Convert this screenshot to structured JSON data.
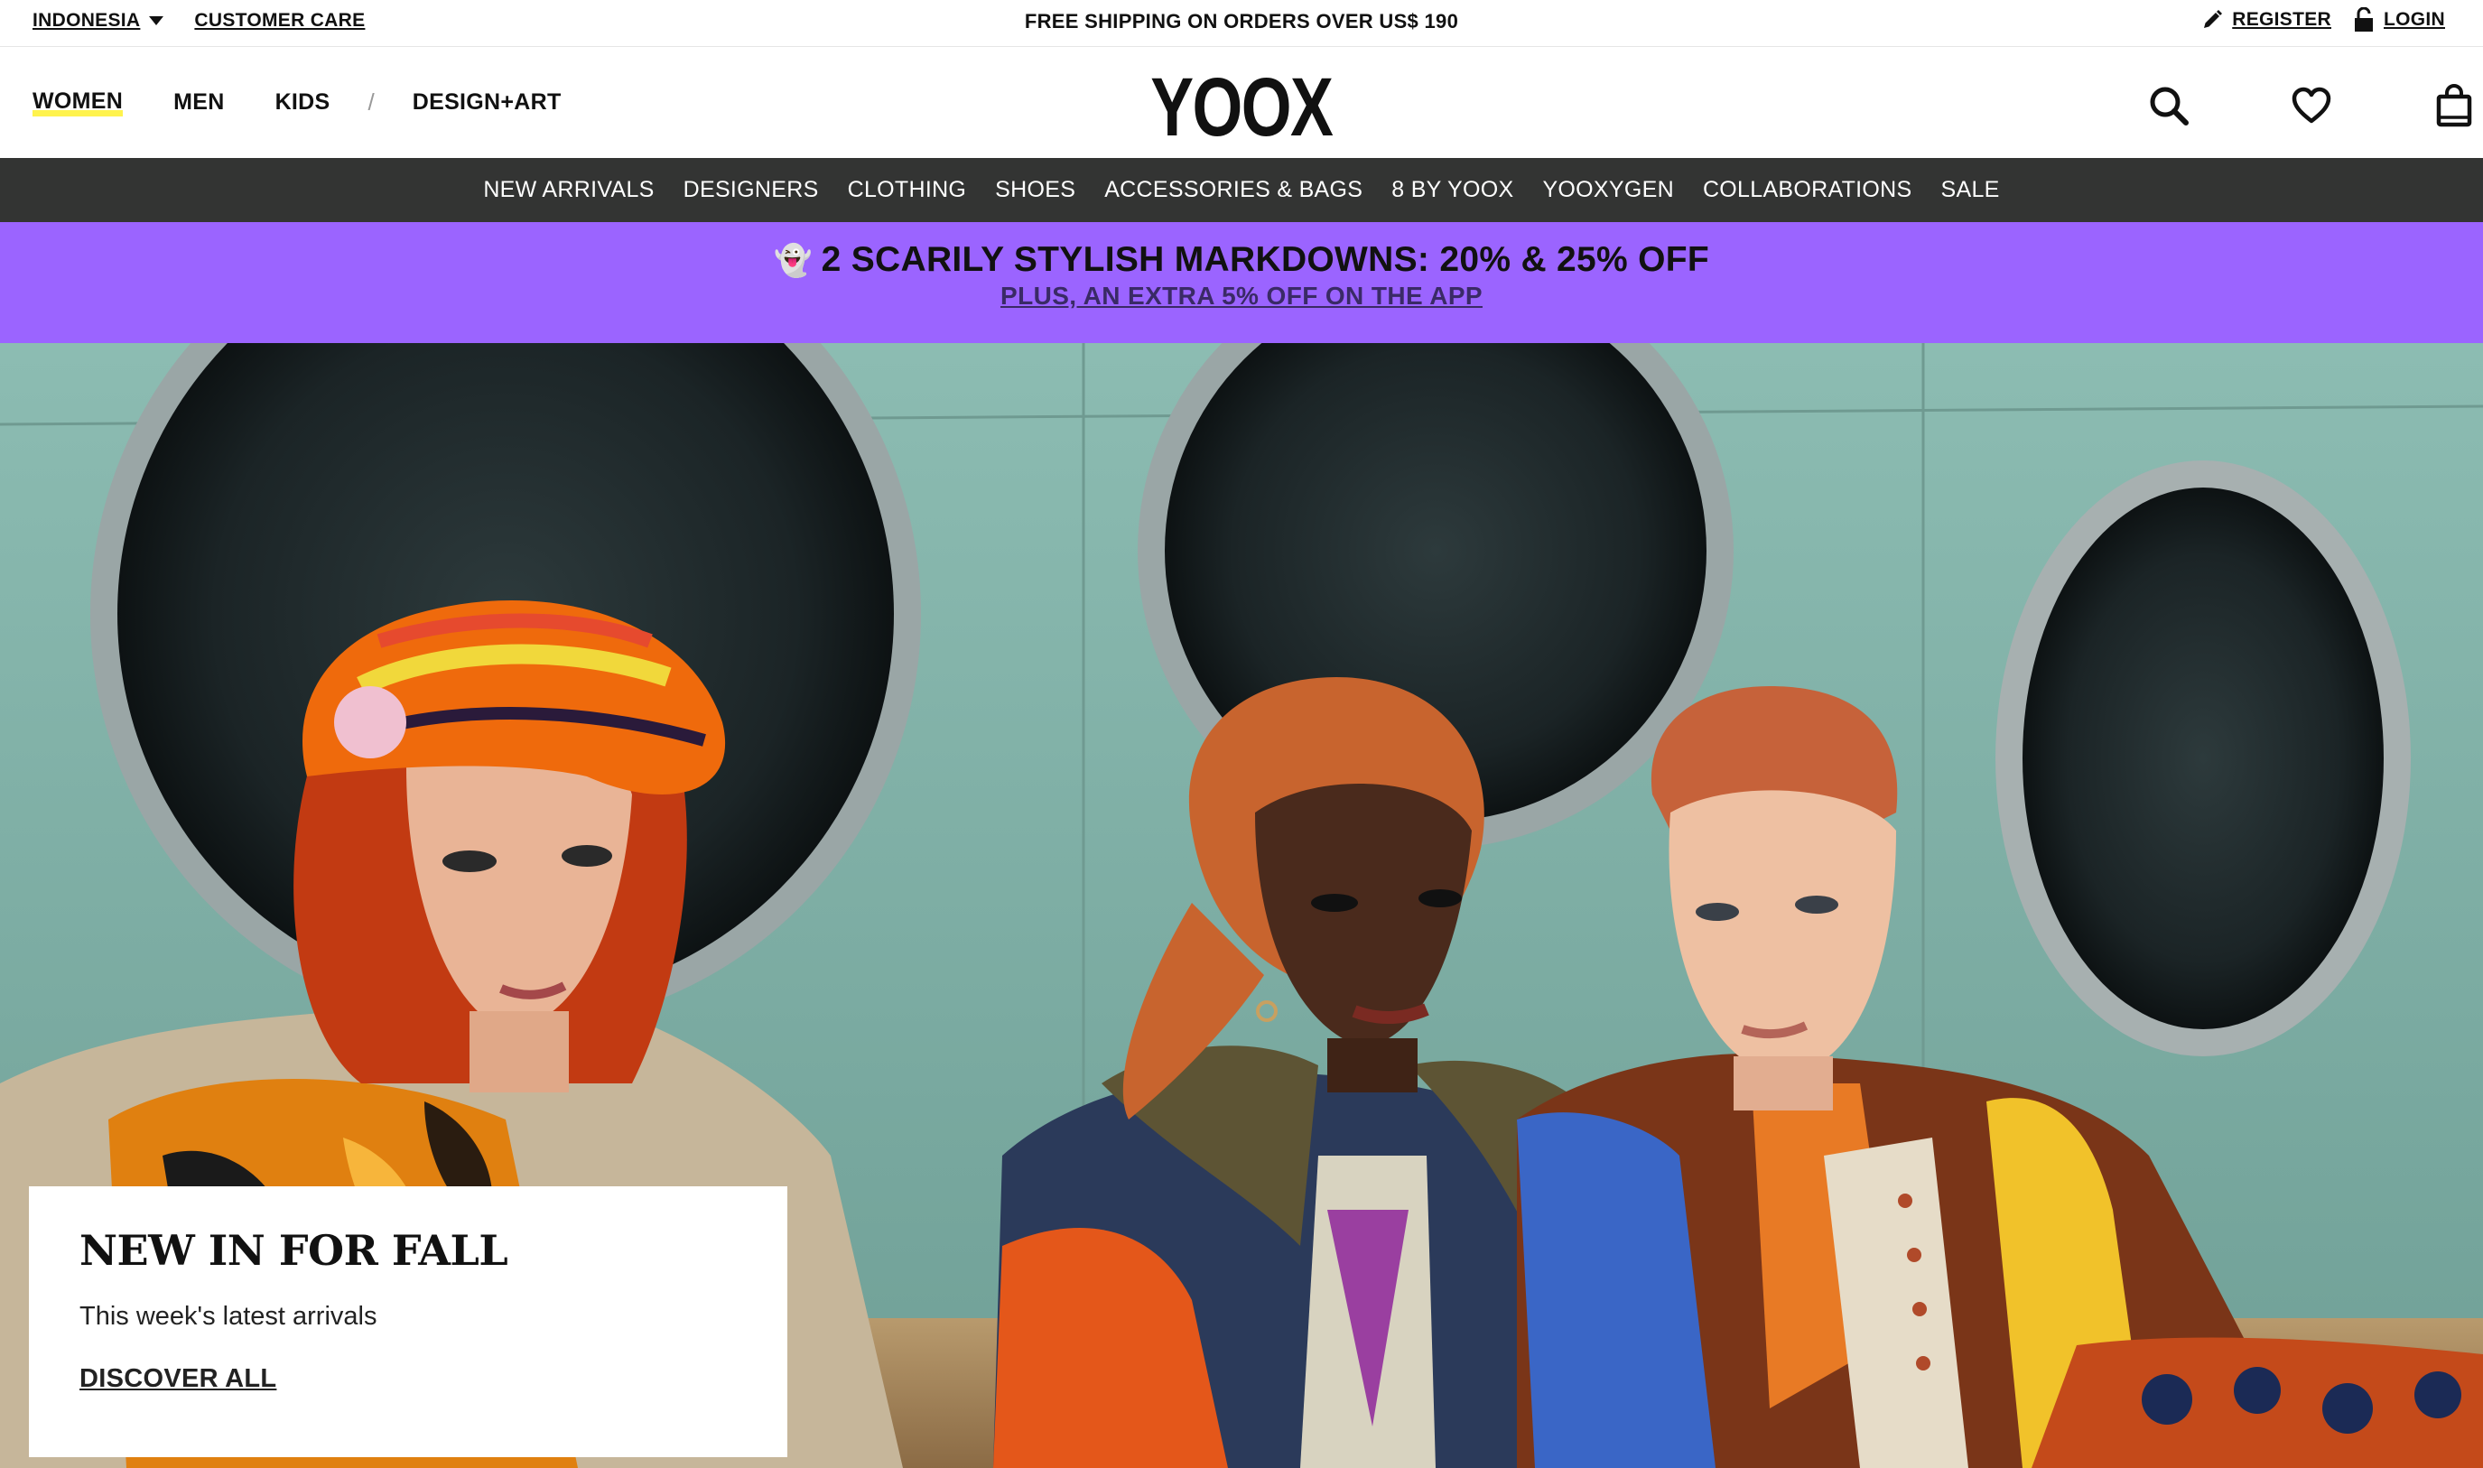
{
  "utility_bar": {
    "country": "INDONESIA",
    "customer_care": "CUSTOMER CARE",
    "shipping_message": "FREE SHIPPING ON ORDERS OVER US$ 190",
    "register": "REGISTER",
    "login": "LOGIN"
  },
  "header": {
    "logo": "YOOX",
    "gender_tabs": [
      {
        "label": "WOMEN",
        "active": true
      },
      {
        "label": "MEN",
        "active": false
      },
      {
        "label": "KIDS",
        "active": false
      }
    ],
    "separator": "/",
    "design_art": "DESIGN+ART",
    "icons": [
      "search-icon",
      "heart-icon",
      "shopping-bag-icon"
    ]
  },
  "category_nav": {
    "items": [
      "NEW ARRIVALS",
      "DESIGNERS",
      "CLOTHING",
      "SHOES",
      "ACCESSORIES & BAGS",
      "8 BY YOOX",
      "YOOXYGEN",
      "COLLABORATIONS",
      "SALE"
    ]
  },
  "promo": {
    "emoji": "👻",
    "headline": "2 SCARILY STYLISH MARKDOWNS: 20% & 25% OFF",
    "subline": "PLUS, AN EXTRA 5% OFF ON THE APP",
    "background": "#9b64ff"
  },
  "hero": {
    "card": {
      "title": "NEW IN FOR FALL",
      "subtitle": "This week's latest arrivals",
      "cta": "DISCOVER ALL"
    }
  },
  "colors": {
    "nav_bg": "#333433",
    "active_underline": "#fff34d",
    "hero_bg": "#7fb3a6"
  }
}
